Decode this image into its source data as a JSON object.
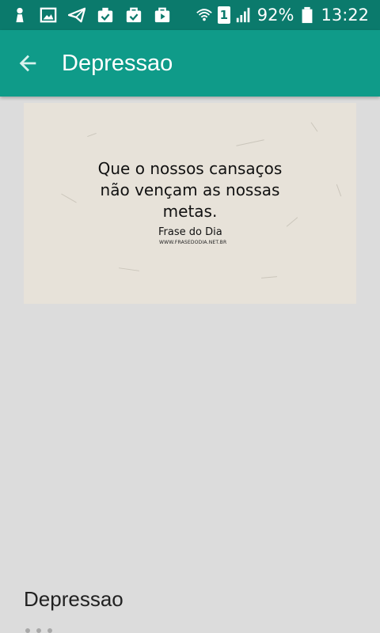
{
  "status_bar": {
    "battery": "92%",
    "time": "13:22",
    "sim": "1",
    "icons": [
      "person-icon",
      "image-icon",
      "send-icon",
      "clipboard-check-icon",
      "briefcase-check-icon",
      "briefcase-play-icon",
      "wifi-icon",
      "sim-icon",
      "signal-icon",
      "battery-icon"
    ]
  },
  "app_bar": {
    "title": "Depressao",
    "back_icon": "arrow-left-icon"
  },
  "quote_image": {
    "lines": [
      "Que o nossos cansaços",
      "não vençam as nossas",
      "metas."
    ],
    "brand": "Frase do Dia",
    "url": "WWW.FRASEDODIA.NET.BR"
  },
  "footer": {
    "title": "Depressao"
  },
  "colors": {
    "status_bar": "#0b7a6c",
    "app_bar": "#0f9b89",
    "background": "#dcdcdc",
    "card": "#e7e2d9"
  }
}
